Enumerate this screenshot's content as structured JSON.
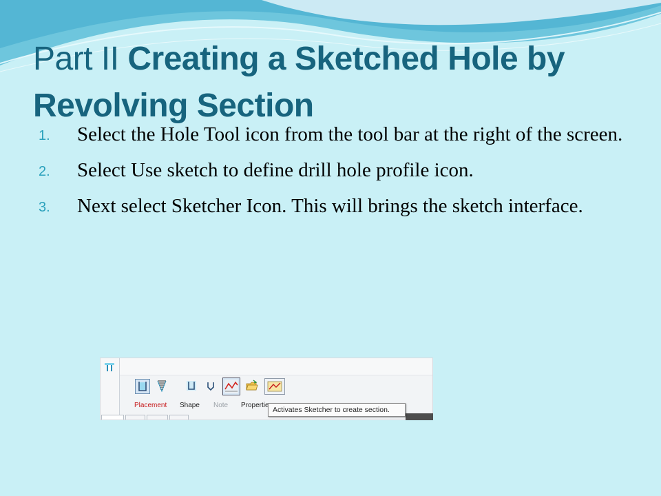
{
  "title": {
    "prefix": "Part II ",
    "bold": "Creating a Sketched Hole by Revolving Section"
  },
  "steps": [
    {
      "num": "1.",
      "text": "Select the Hole Tool icon from the tool bar at the right of the screen."
    },
    {
      "num": "2.",
      "text": "Select Use sketch to define drill hole profile icon."
    },
    {
      "num": "3.",
      "text": "Next select Sketcher Icon. This will brings the sketch interface."
    }
  ],
  "toolbar": {
    "tabs": {
      "placement": "Placement",
      "shape": "Shape",
      "note": "Note",
      "properties": "Properties"
    },
    "tooltip": "Activates Sketcher to create section.",
    "icons": [
      "hole-tool-icon",
      "straight-hole-icon",
      "standard-hole-icon",
      "simple-profile-icon",
      "sketch-profile-icon",
      "sketch-drill-profile-icon",
      "open-folder-icon",
      "sketcher-icon"
    ]
  },
  "colors": {
    "background": "#c9f0f6",
    "title": "#17647e",
    "numbers": "#2aa1bc",
    "placement": "#c6191b"
  }
}
